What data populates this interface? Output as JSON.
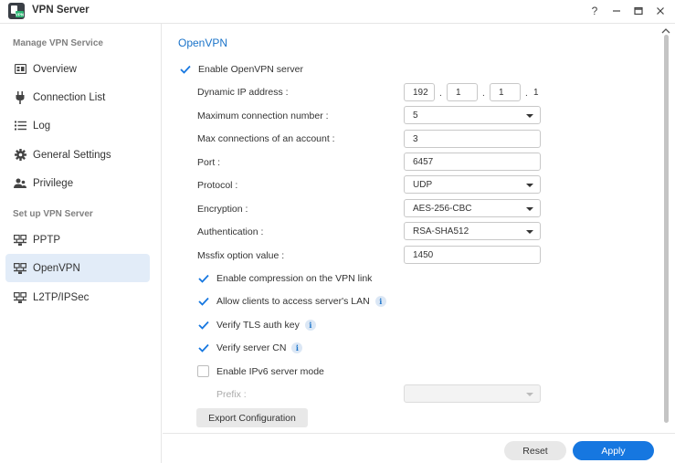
{
  "window": {
    "title": "VPN Server",
    "controls": {
      "help": "?",
      "minimize": "—",
      "maximize": "□",
      "close": "✕"
    }
  },
  "sidebar": {
    "section1": "Manage VPN Service",
    "section2": "Set up VPN Server",
    "items": [
      {
        "label": "Overview",
        "icon": "overview-icon"
      },
      {
        "label": "Connection List",
        "icon": "plug-icon"
      },
      {
        "label": "Log",
        "icon": "list-icon"
      },
      {
        "label": "General Settings",
        "icon": "gear-icon"
      },
      {
        "label": "Privilege",
        "icon": "users-icon"
      },
      {
        "label": "PPTP",
        "icon": "network-icon"
      },
      {
        "label": "OpenVPN",
        "icon": "network-icon",
        "active": true
      },
      {
        "label": "L2TP/IPSec",
        "icon": "network-icon"
      }
    ]
  },
  "main": {
    "title": "OpenVPN",
    "enable_server": {
      "label": "Enable OpenVPN server",
      "checked": true
    },
    "dynamic_ip": {
      "label": "Dynamic IP address :",
      "octets": [
        "192",
        "1",
        "1",
        "1"
      ],
      "dot": "."
    },
    "max_conn": {
      "label": "Maximum connection number :",
      "value": "5"
    },
    "max_conn_account": {
      "label": "Max connections of an account :",
      "value": "3"
    },
    "port": {
      "label": "Port :",
      "value": "6457"
    },
    "protocol": {
      "label": "Protocol :",
      "value": "UDP"
    },
    "encryption": {
      "label": "Encryption :",
      "value": "AES-256-CBC"
    },
    "authentication": {
      "label": "Authentication :",
      "value": "RSA-SHA512"
    },
    "mssfix": {
      "label": "Mssfix option value :",
      "value": "1450"
    },
    "checkboxes": [
      {
        "label": "Enable compression on the VPN link",
        "checked": true,
        "info": false
      },
      {
        "label": "Allow clients to access server's LAN",
        "checked": true,
        "info": true
      },
      {
        "label": "Verify TLS auth key",
        "checked": true,
        "info": true
      },
      {
        "label": "Verify server CN",
        "checked": true,
        "info": true
      },
      {
        "label": "Enable IPv6 server mode",
        "checked": false,
        "info": false
      }
    ],
    "prefix": {
      "label": "Prefix :",
      "value": ""
    },
    "export_button": "Export Configuration",
    "info_glyph": "i"
  },
  "footer": {
    "reset": "Reset",
    "apply": "Apply"
  },
  "colors": {
    "accent": "#1677e0",
    "title_blue": "#1a73c9",
    "active_bg": "#e2ecf8"
  }
}
